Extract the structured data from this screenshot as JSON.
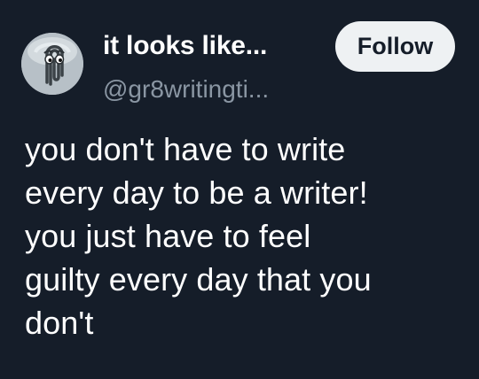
{
  "author": {
    "display_name": "it looks like...",
    "handle": "@gr8writingti...",
    "avatar_icon": "paperclip-assistant-icon"
  },
  "actions": {
    "follow_label": "Follow"
  },
  "tweet": {
    "lines": [
      "you don't have to write",
      "every day to be a writer!",
      "you just have to feel",
      "guilty every day that you",
      "don't"
    ]
  },
  "colors": {
    "background": "#151d29",
    "text": "#ffffff",
    "handle": "#8a96a3",
    "follow_button_bg": "#eef1f3"
  }
}
